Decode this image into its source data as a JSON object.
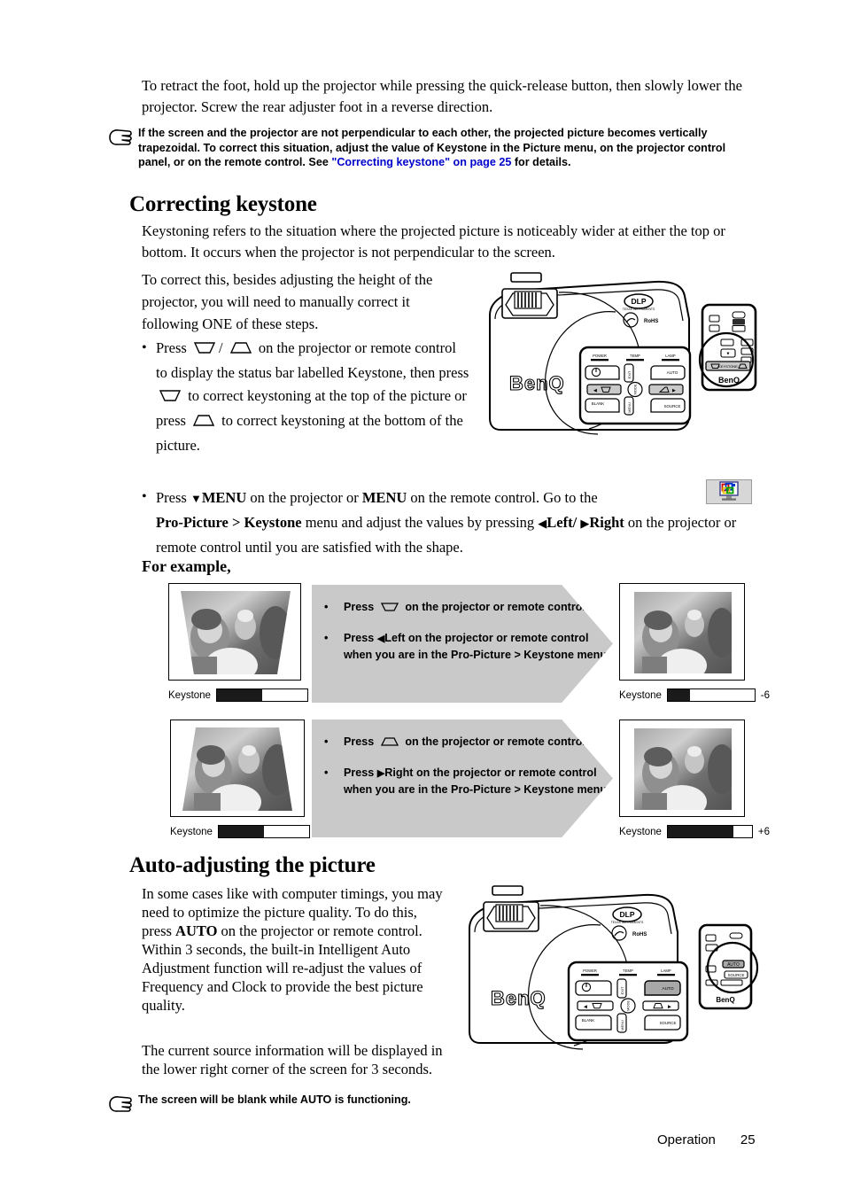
{
  "page": {
    "footer_section": "Operation",
    "footer_page": "25"
  },
  "intro": {
    "paragraph": "To retract the foot, hold up the projector while pressing the quick-release button, then slowly lower the projector. Screw the rear adjuster foot in a reverse direction."
  },
  "note_top": {
    "icon": "pointing-hand-icon",
    "text_part1": "If the screen and the projector are not perpendicular to each other, the projected picture becomes vertically trapezoidal. To correct this situation, adjust the value of Keystone in the Picture menu, on the projector control panel, or on the remote control. See ",
    "link_text": "\"Correcting keystone\" on page 25",
    "text_part2": " for details."
  },
  "keystone_section": {
    "title": "Correcting keystone",
    "intro": "Keystoning refers to the situation where the projected picture is noticeably wider at either the top or bottom. It occurs when the projector is not perpendicular to the screen.",
    "lead": "To correct this, besides adjusting the height of the projector, you will need to manually correct it following ONE of these steps.",
    "bullet1": {
      "t1": "Press",
      "icon_down": "keystone-down-icon",
      "sep": "/",
      "icon_up": "keystone-up-icon",
      "t2": "on the projector or remote control to display the status bar labelled Keystone, then press",
      "icon_down2": "keystone-down-icon",
      "t3": "to correct keystoning at the top of the picture or press",
      "icon_up2": "keystone-up-icon",
      "t4": "to correct keystoning at the bottom of the picture."
    },
    "bullet2": {
      "t1": "Press",
      "menu_proj": "MENU",
      "t2": "on the projector or",
      "menu_remote": "MENU",
      "t3": "on the remote control. Go to the",
      "icon_menu": "menu-monitor-icon",
      "path": "Pro-Picture > Keystone",
      "t4": "menu and adjust the values by pressing",
      "left_label": "Left/",
      "right_label": "Right",
      "t5": "on the projector or remote control until you are satisfied with the shape."
    },
    "for_example_label": "For example,"
  },
  "examples": [
    {
      "shape": "wide-top",
      "bar_label": "Keystone",
      "bar_value": "0",
      "bar_fill_percent": 50,
      "callout": {
        "item1_icon": "keystone-down-icon",
        "item1_text_before": "Press",
        "item1_text_after": "on the projector or remote control.",
        "item2_arrow": "left-arrow-icon",
        "item2_text": "Left on the projector or remote control when you are in the Pro-Picture > Keystone menu.",
        "item2_text_before": "Press"
      },
      "result": {
        "shape": "rectangular",
        "bar_label": "Keystone",
        "bar_value": "-6",
        "bar_fill_percent": 26
      }
    },
    {
      "shape": "wide-bottom",
      "bar_label": "Keystone",
      "bar_value": "0",
      "bar_fill_percent": 50,
      "callout": {
        "item1_icon": "keystone-up-icon",
        "item1_text_before": "Press",
        "item1_text_after": "on the projector or remote control.",
        "item2_arrow": "right-arrow-icon",
        "item2_text": "Right on the projector or remote control when you are in the Pro-Picture > Keystone menu.",
        "item2_text_before": "Press"
      },
      "result": {
        "shape": "rectangular",
        "bar_label": "Keystone",
        "bar_value": "+6",
        "bar_fill_percent": 78
      }
    }
  ],
  "auto_section": {
    "title": "Auto-adjusting the picture",
    "para1_a": "In some cases like with computer timings, you may need to optimize the picture quality. To do this, press ",
    "para1_auto": "AUTO",
    "para1_b": " on the projector or remote control. Within 3 seconds, the built-in Intelligent Auto Adjustment function will re-adjust the values of Frequency and Clock to provide the best picture quality.",
    "para2": "The current source information will be displayed in the lower right corner of the screen for 3 seconds.",
    "note": {
      "icon": "pointing-hand-icon",
      "text": "The screen will be blank while AUTO is functioning."
    }
  },
  "projector_figure": {
    "brand": "BenQ",
    "dlp_label": "DLP",
    "dlp_sub": "TEXAS INSTRUMENTS",
    "rohs_label": "RoHS",
    "indicators": [
      "POWER",
      "TEMP",
      "LAMP"
    ],
    "buttons": [
      "AUTO",
      "MODE",
      "BLANK",
      "SOURCE"
    ],
    "arrow_labels": [
      "EXIT",
      "MENU"
    ],
    "remote_brand": "BenQ",
    "remote_keystone_label": "KEYSTONE"
  },
  "projector_figure2": {
    "brand": "BenQ",
    "dlp_label": "DLP",
    "dlp_sub": "TEXAS INSTRUMENTS",
    "rohs_label": "RoHS",
    "indicators": [
      "POWER",
      "TEMP",
      "LAMP"
    ],
    "buttons": [
      "AUTO",
      "MODE",
      "BLANK",
      "SOURCE"
    ],
    "remote_brand": "BenQ",
    "remote_auto_label": "AUTO",
    "remote_source_label": "SOURCE"
  },
  "colors": {
    "link": "#0000cc",
    "callout_bg": "#c9c9c9",
    "bar_fill": "#1a1a1a"
  }
}
